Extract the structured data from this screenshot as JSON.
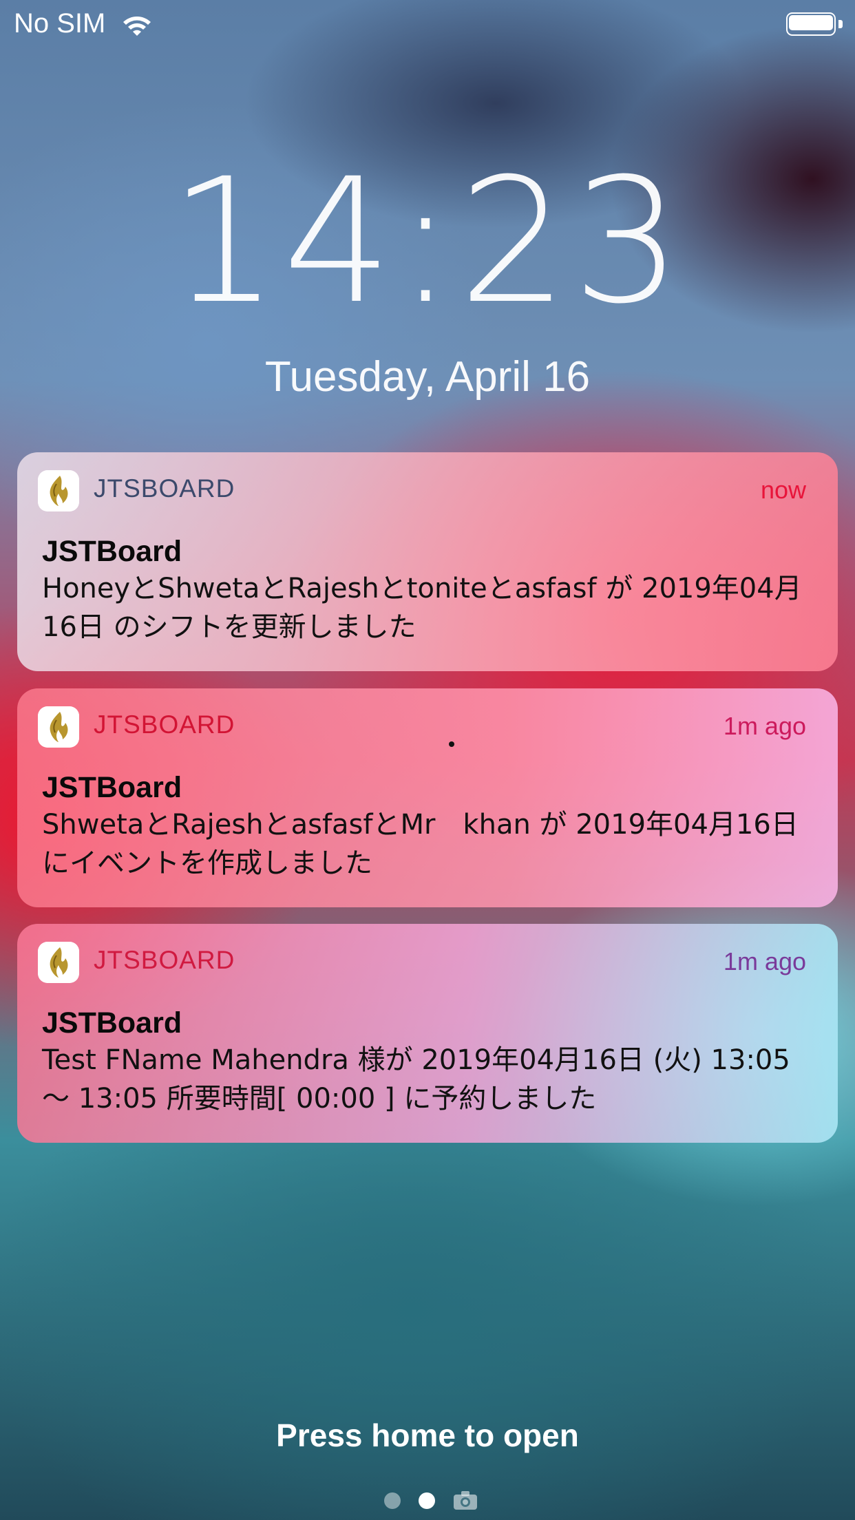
{
  "status_bar": {
    "carrier": "No SIM",
    "battery_level": 1.0
  },
  "lock_screen": {
    "time": "14:23",
    "date": "Tuesday, April 16"
  },
  "notifications": [
    {
      "app_name": "JTSBOARD",
      "time": "now",
      "title": "JSTBoard",
      "body": "HoneyとShwetaとRajeshとtoniteとasfasf が 2019年04月16日 のシフトを更新しました",
      "icon": "flame-logo-icon"
    },
    {
      "app_name": "JTSBOARD",
      "time": "1m ago",
      "title": "JSTBoard",
      "body": "ShwetaとRajeshとasfasfとMr　khan が 2019年04月16日 にイベントを作成しました",
      "icon": "flame-logo-icon"
    },
    {
      "app_name": "JTSBOARD",
      "time": "1m ago",
      "title": "JSTBoard",
      "body": "Test FName Mahendra 様が 2019年04月16日 (火) 13:05 ～ 13:05 所要時間[ 00:00 ] に予約しました",
      "icon": "flame-logo-icon"
    }
  ],
  "footer": {
    "hint": "Press home to open",
    "page_count": 2,
    "current_page": 2,
    "camera_icon": "camera-icon"
  },
  "colors": {
    "now_label": "#e8143a",
    "app_name_red": "#d21434",
    "icon_gold": "#b8962e"
  }
}
